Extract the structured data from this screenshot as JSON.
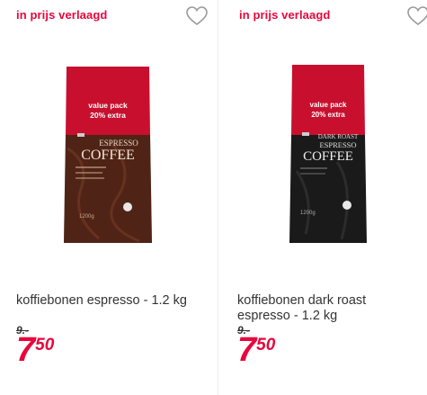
{
  "products": [
    {
      "badge": "in prijs verlaagd",
      "title": "koffiebonen espresso - 1.2 kg",
      "old_price": "9.-",
      "price_int": "7",
      "price_dec": "50",
      "pack": {
        "banner_line1": "value pack",
        "banner_line2": "20% extra",
        "brand": "hema",
        "sub": "ESPRESSO",
        "name": "COFFEE",
        "weight": "1200g"
      },
      "colors": {
        "top": "#c8102e",
        "bag": "#5a2a1a"
      }
    },
    {
      "badge": "in prijs verlaagd",
      "title": "koffiebonen dark roast espresso - 1.2 kg",
      "old_price": "9.-",
      "price_int": "7",
      "price_dec": "50",
      "pack": {
        "banner_line1": "value pack",
        "banner_line2": "20% extra",
        "brand": "hema",
        "sub": "DARK ROAST",
        "sub2": "ESPRESSO",
        "name": "COFFEE",
        "weight": "1200g"
      },
      "colors": {
        "top": "#c8102e",
        "bag": "#1a1a1a"
      }
    }
  ],
  "icons": {
    "favorite": "heart-outline-icon"
  },
  "accent": "#e8063c"
}
